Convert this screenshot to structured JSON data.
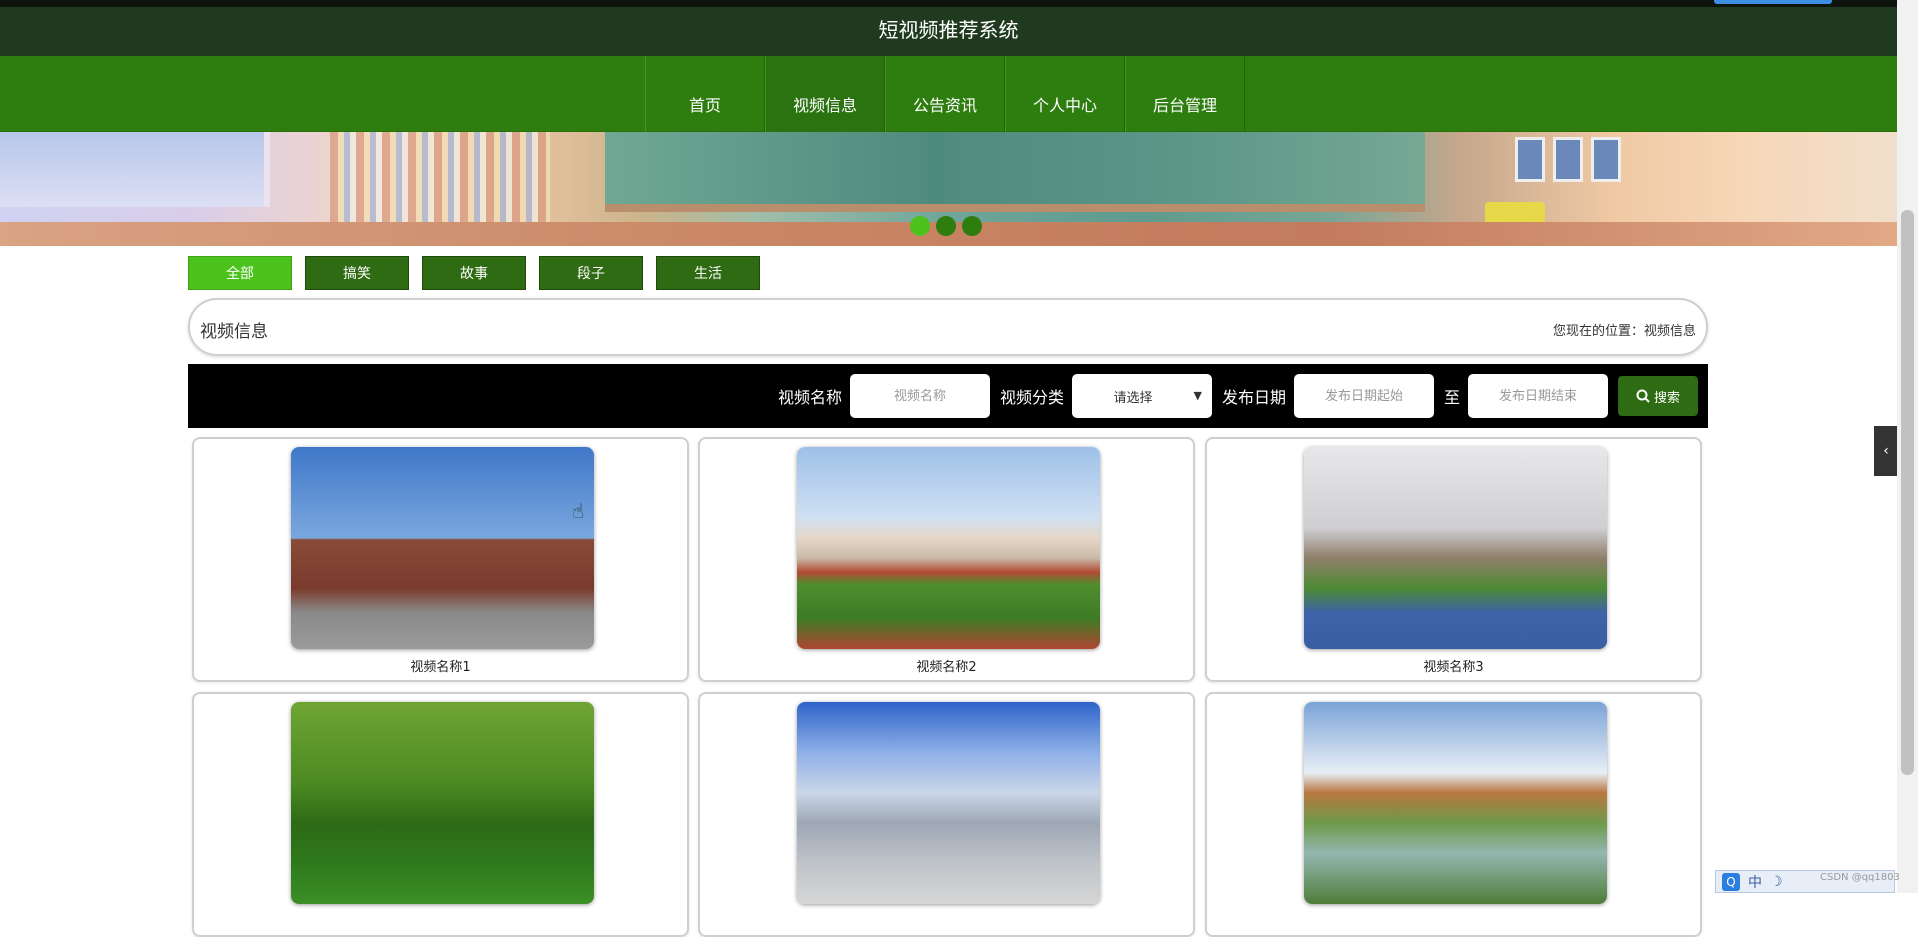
{
  "header": {
    "title": "短视频推荐系统"
  },
  "nav": {
    "items": [
      "首页",
      "视频信息",
      "公告资讯",
      "个人中心",
      "后台管理"
    ]
  },
  "filters": {
    "items": [
      "全部",
      "搞笑",
      "故事",
      "段子",
      "生活"
    ],
    "active": 0
  },
  "section": {
    "title": "视频信息",
    "breadcrumb_prefix": "您现在的位置：",
    "breadcrumb_current": "视频信息"
  },
  "search": {
    "name_label": "视频名称",
    "name_placeholder": "视频名称",
    "category_label": "视频分类",
    "category_value": "请选择",
    "date_label": "发布日期",
    "date_start_placeholder": "发布日期起始",
    "date_sep": "至",
    "date_end_placeholder": "发布日期结束",
    "button_label": "搜索"
  },
  "videos": [
    {
      "name": "视频名称1"
    },
    {
      "name": "视频名称2"
    },
    {
      "name": "视频名称3"
    },
    {
      "name": ""
    },
    {
      "name": ""
    },
    {
      "name": ""
    }
  ],
  "colors": {
    "nav_green": "#2e7d0f",
    "active_green": "#4cc21c",
    "dark_green": "#2e6b12",
    "header": "#1f3a1f"
  },
  "ime": {
    "label": "中"
  },
  "watermark": "CSDN @qq1803"
}
